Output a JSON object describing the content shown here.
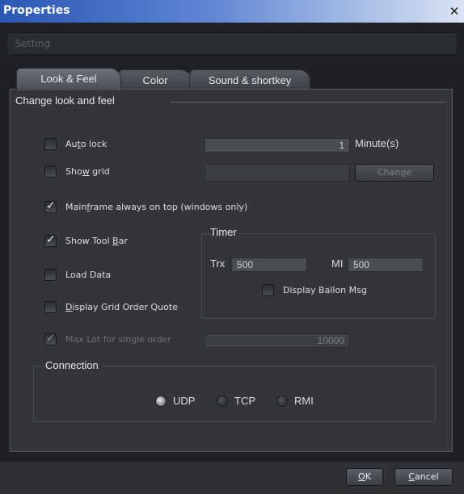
{
  "window": {
    "title": "Properties",
    "close_glyph": "✕"
  },
  "setting": {
    "label": "Setting"
  },
  "tabs": [
    {
      "label": "Look & Feel",
      "active": true
    },
    {
      "label": "Color",
      "active": false
    },
    {
      "label": "Sound & shortkey",
      "active": false
    }
  ],
  "panel": {
    "title": "Change look and feel"
  },
  "options": {
    "auto_lock": {
      "pre": "Au",
      "mnemonic": "t",
      "post": "o lock",
      "checked": false
    },
    "minutes_value": "1",
    "minutes_unit": "Minute(s)",
    "show_grid": {
      "pre": "Sho",
      "mnemonic": "w",
      "post": " grid",
      "checked": false
    },
    "grid_value": "",
    "change_button": "Change",
    "mainframe": {
      "pre": "Main",
      "mnemonic": "f",
      "post": "rame always on top (windows only)",
      "checked": true
    },
    "show_toolbar": {
      "pre": "Show Tool ",
      "mnemonic": "B",
      "post": "ar",
      "checked": true
    },
    "load_data": {
      "label": "Load Data",
      "checked": false
    },
    "display_grid_order": {
      "pre": "",
      "mnemonic": "D",
      "post": "isplay Grid Order Quote",
      "checked": false
    },
    "max_lot": {
      "label": "Max Lot for single order",
      "checked": true,
      "value": "10000"
    }
  },
  "timer": {
    "title": "Timer",
    "trx_label": "Trx",
    "trx_value": "500",
    "mi_label": "MI",
    "mi_value": "500",
    "ballon_label": "Display Ballon Msg",
    "ballon_checked": false
  },
  "connection": {
    "title": "Connection",
    "options": [
      {
        "label": "UDP",
        "selected": true
      },
      {
        "label": "TCP",
        "selected": false
      },
      {
        "label": "RMI",
        "selected": false
      }
    ]
  },
  "footer": {
    "ok": {
      "mnemonic": "O",
      "rest": "K"
    },
    "cancel": {
      "mnemonic": "C",
      "rest": "ancel"
    }
  }
}
